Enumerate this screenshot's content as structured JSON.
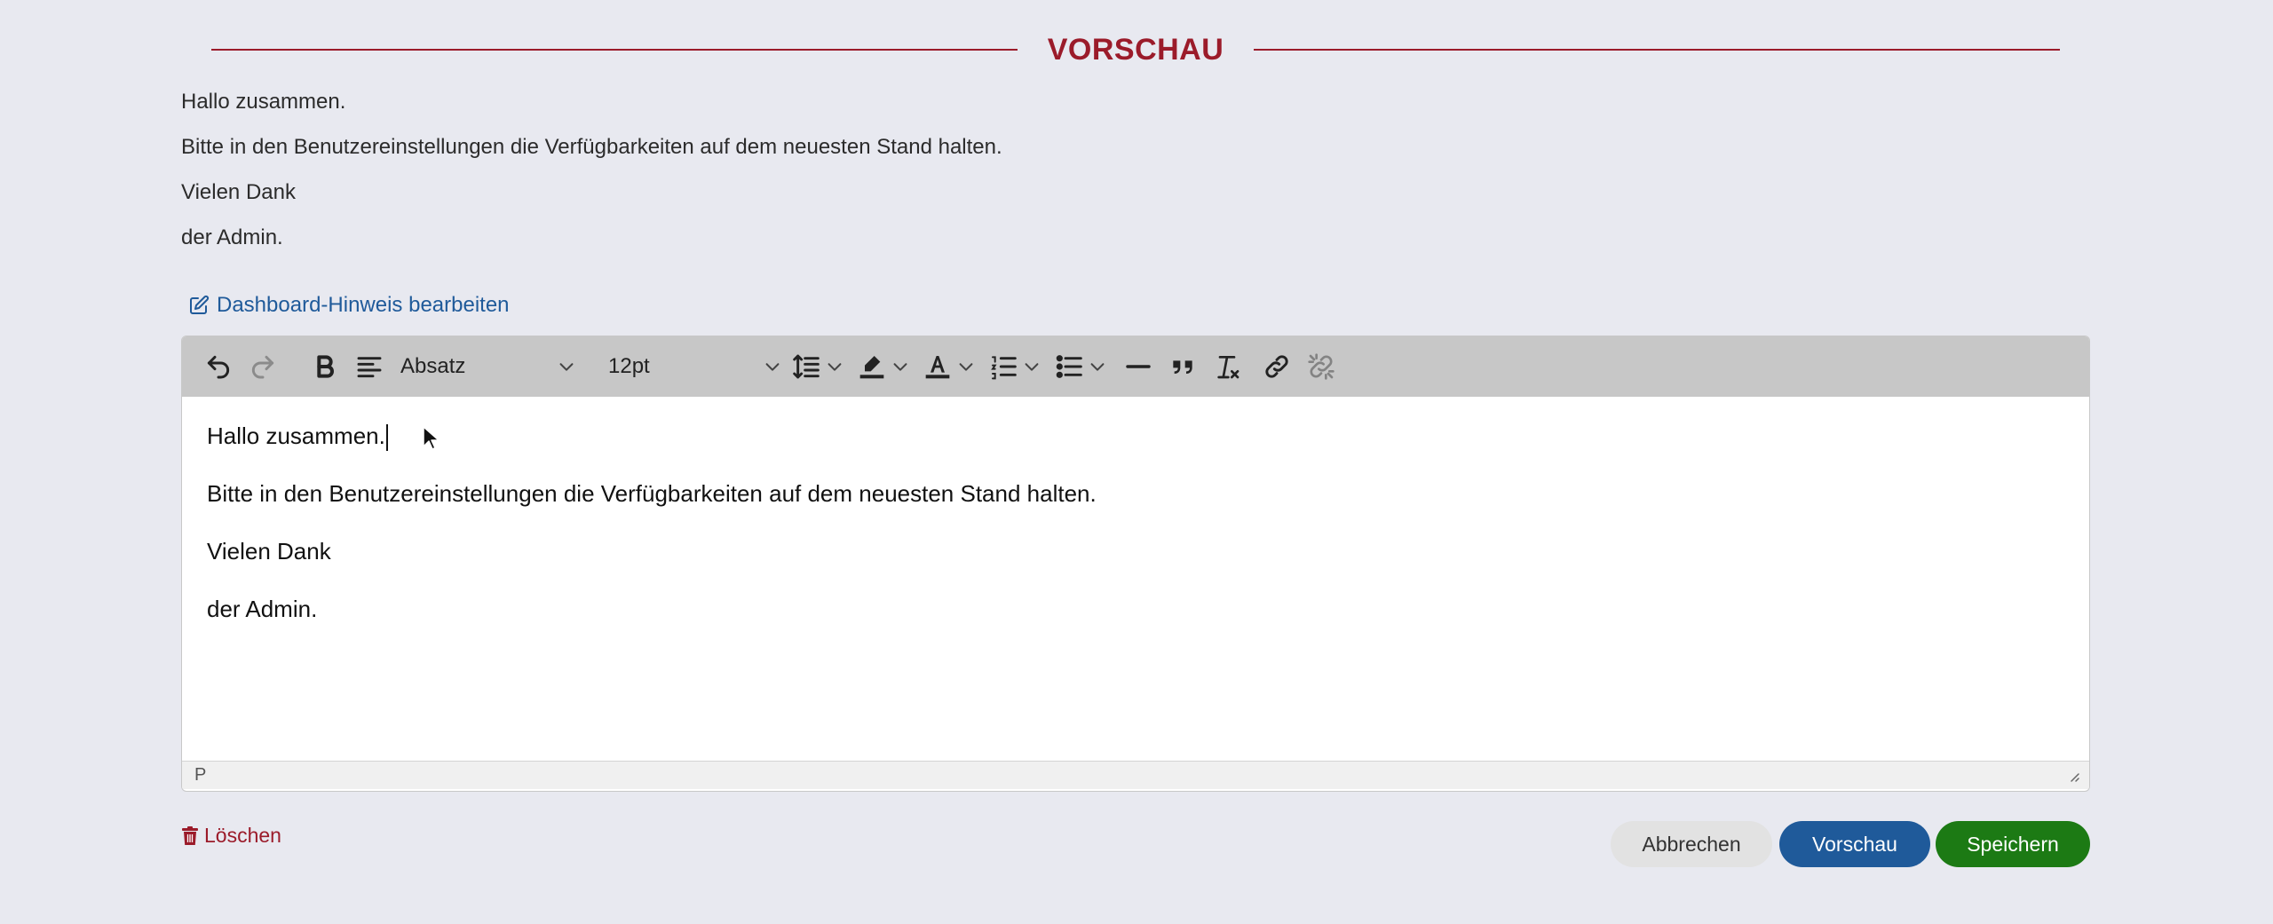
{
  "section": {
    "title": "VORSCHAU"
  },
  "preview": {
    "lines": [
      "Hallo zusammen.",
      "Bitte in den Benutzereinstellungen die Verfügbarkeiten auf dem neuesten Stand halten.",
      "Vielen Dank",
      "der Admin."
    ]
  },
  "edit_link": {
    "label": "Dashboard-Hinweis bearbeiten",
    "icon": "edit-icon"
  },
  "toolbar": {
    "block_format": "Absatz",
    "font_size": "12pt",
    "icons": [
      "undo-icon",
      "redo-icon",
      "bold-icon",
      "align-left-icon",
      "line-height-icon",
      "highlight-icon",
      "text-color-icon",
      "numbered-list-icon",
      "bullet-list-icon",
      "horizontal-rule-icon",
      "blockquote-icon",
      "clear-format-icon",
      "link-icon",
      "unlink-icon"
    ]
  },
  "editor": {
    "lines": [
      "Hallo zusammen.",
      "Bitte in den Benutzereinstellungen die Verfügbarkeiten auf dem neuesten Stand halten.",
      "Vielen Dank",
      "der Admin."
    ],
    "status_path": "P"
  },
  "actions": {
    "delete_label": "Löschen",
    "cancel_label": "Abbrechen",
    "preview_label": "Vorschau",
    "save_label": "Speichern"
  },
  "colors": {
    "accent_red": "#9b1b2a",
    "link_blue": "#1f5a9a",
    "save_green": "#1c7a14",
    "background": "#e8e9f0"
  }
}
